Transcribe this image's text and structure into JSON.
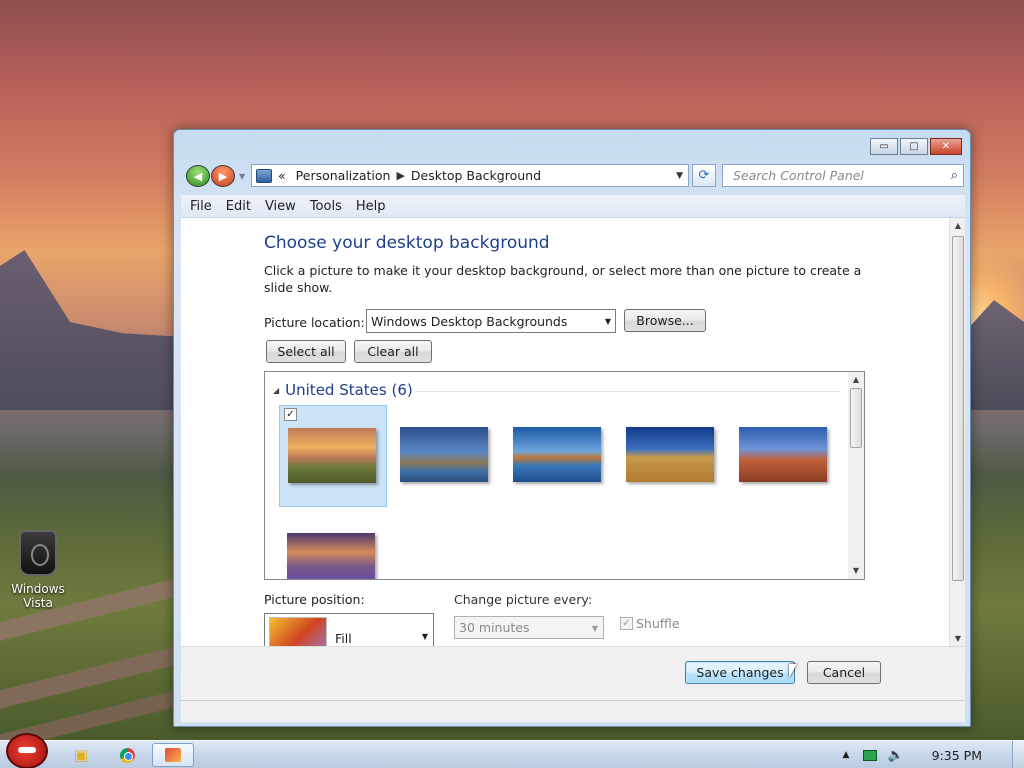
{
  "desktop": {
    "icons": [
      {
        "label": "Windows Vista",
        "icon": "recycle-bin-icon"
      }
    ]
  },
  "window": {
    "caption_buttons": {
      "minimize": "▭",
      "maximize": "□",
      "close": "✕"
    },
    "nav": {
      "back_glyph": "◀",
      "forward_glyph": "▶",
      "address": {
        "chevron": "«",
        "crumb_1": "Personalization",
        "separator": "▶",
        "crumb_2": "Desktop Background"
      },
      "refresh_glyph": "⟳",
      "search_placeholder": "Search Control Panel",
      "search_glyph": "⌕"
    },
    "menu": [
      "File",
      "Edit",
      "View",
      "Tools",
      "Help"
    ],
    "content": {
      "title": "Choose your desktop background",
      "description": "Click a picture to make it your desktop background, or select more than one picture to create a slide show.",
      "picture_location_label": "Picture location:",
      "picture_location_value": "Windows Desktop Backgrounds",
      "browse_label": "Browse...",
      "select_all_label": "Select all",
      "clear_all_label": "Clear all",
      "group_title": "United States (6)",
      "pictures": [
        {
          "name": "sunset-field",
          "selected": true
        },
        {
          "name": "lighthouse-coast",
          "selected": false
        },
        {
          "name": "rock-lake",
          "selected": false
        },
        {
          "name": "hay-bale-field",
          "selected": false
        },
        {
          "name": "delicate-arch",
          "selected": false
        },
        {
          "name": "lake-flowers",
          "selected": false
        }
      ],
      "picture_position_label": "Picture position:",
      "picture_position_value": "Fill",
      "change_picture_label": "Change picture every:",
      "change_picture_value": "30 minutes",
      "shuffle_label": "Shuffle",
      "shuffle_checked": true
    },
    "footer": {
      "save_label": "Save changes",
      "cancel_label": "Cancel"
    }
  },
  "taskbar": {
    "items": [
      "angry-birds-start-icon",
      "windows-explorer-icon",
      "chrome-icon",
      "personalization-window-icon"
    ],
    "tray": {
      "expand_glyph": "▲",
      "volume_glyph": "🔈",
      "time": "9:35 PM"
    }
  }
}
